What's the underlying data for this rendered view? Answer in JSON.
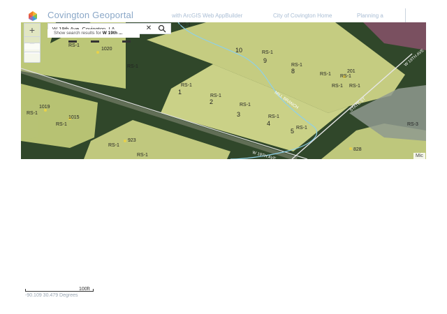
{
  "header": {
    "title": "Covington Geoportal",
    "built_with": "with ArcGIS Web AppBuilder",
    "links": [
      "City of Covington Home",
      "Planning a"
    ]
  },
  "search": {
    "value": "W 19th Ave, Covington, LA,",
    "suggestion_prefix": "Show search results for ",
    "suggestion_term": "W 19th ..."
  },
  "zoom": {
    "in": "+",
    "out": "−"
  },
  "icons": {
    "logo": "geoportal-logo-icon",
    "clear": "close-icon",
    "search": "search-icon"
  },
  "map": {
    "zoning_labels": [
      "RS-1",
      "RS-1",
      "RS-1",
      "RS-1",
      "RS-1",
      "RS-1",
      "RS-1",
      "RS-1",
      "RS-1",
      "RS-1",
      "RS-1",
      "RS-1",
      "RS-1",
      "RS-1",
      "RS-1",
      "RS-1",
      "RS-1",
      "RS-1",
      "RS-3"
    ],
    "lot_numbers": [
      "10",
      "9",
      "8",
      "1",
      "2",
      "3",
      "4",
      "5"
    ],
    "address_numbers": [
      "1020",
      "201",
      "1019",
      "1015",
      "923",
      "828"
    ],
    "creek_label": "MILL BRANCH",
    "road_labels": [
      "W 19TH AVE",
      "W 19TH AVE",
      "STATE ST"
    ],
    "attribution": "Mic"
  },
  "scale": {
    "label": "100ft"
  },
  "coordinates": "-90.109 30.479 Degrees",
  "colors": {
    "parcel_fill": "#cfd88a",
    "vegetation": "#2f4a24",
    "header_text": "#8aa7c7",
    "creek": "#8fd0e8",
    "red_parcel": "#7a5060"
  }
}
